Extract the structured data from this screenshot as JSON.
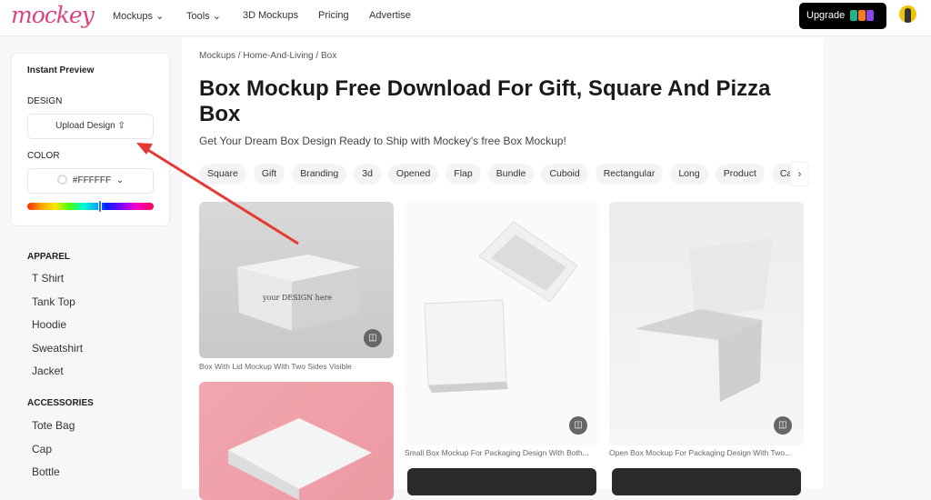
{
  "header": {
    "logo": "mockey",
    "nav": [
      {
        "label": "Mockups ⌄"
      },
      {
        "label": "Tools ⌄"
      },
      {
        "label": "3D Mockups"
      },
      {
        "label": "Pricing"
      },
      {
        "label": "Advertise"
      }
    ],
    "upgrade": "Upgrade"
  },
  "preview": {
    "title": "Instant Preview",
    "design_label": "DESIGN",
    "upload": "Upload Design",
    "color_label": "COLOR",
    "color_value": "#FFFFFF",
    "hue_fraction": 0.47
  },
  "sidebar": {
    "categories": [
      {
        "title": "APPAREL",
        "items": [
          "T Shirt",
          "Tank Top",
          "Hoodie",
          "Sweatshirt",
          "Jacket"
        ]
      },
      {
        "title": "ACCESSORIES",
        "items": [
          "Tote Bag",
          "Cap",
          "Bottle"
        ]
      }
    ]
  },
  "breadcrumb": [
    "Mockups",
    "Home-And-Living",
    "Box"
  ],
  "page": {
    "title": "Box Mockup Free Download For Gift, Square And Pizza Box",
    "subtitle": "Get Your Dream Box Design Ready to Ship with Mockey's free Box Mockup!"
  },
  "tags": [
    "Square",
    "Gift",
    "Branding",
    "3d",
    "Opened",
    "Flap",
    "Bundle",
    "Cuboid",
    "Rectangular",
    "Long",
    "Product",
    "Cardboard"
  ],
  "mockups": [
    {
      "caption": "Box With Lid Mockup With Two Sides Visible"
    },
    {
      "caption": "Small Box Mockup For Packaging Design With Both..."
    },
    {
      "caption": "Open Box Mockup For Packaging Design With Two..."
    }
  ],
  "box_print": "your DESIGN here",
  "colors": {
    "brand": "#d9467f",
    "annotation_arrow": "#e53935"
  }
}
